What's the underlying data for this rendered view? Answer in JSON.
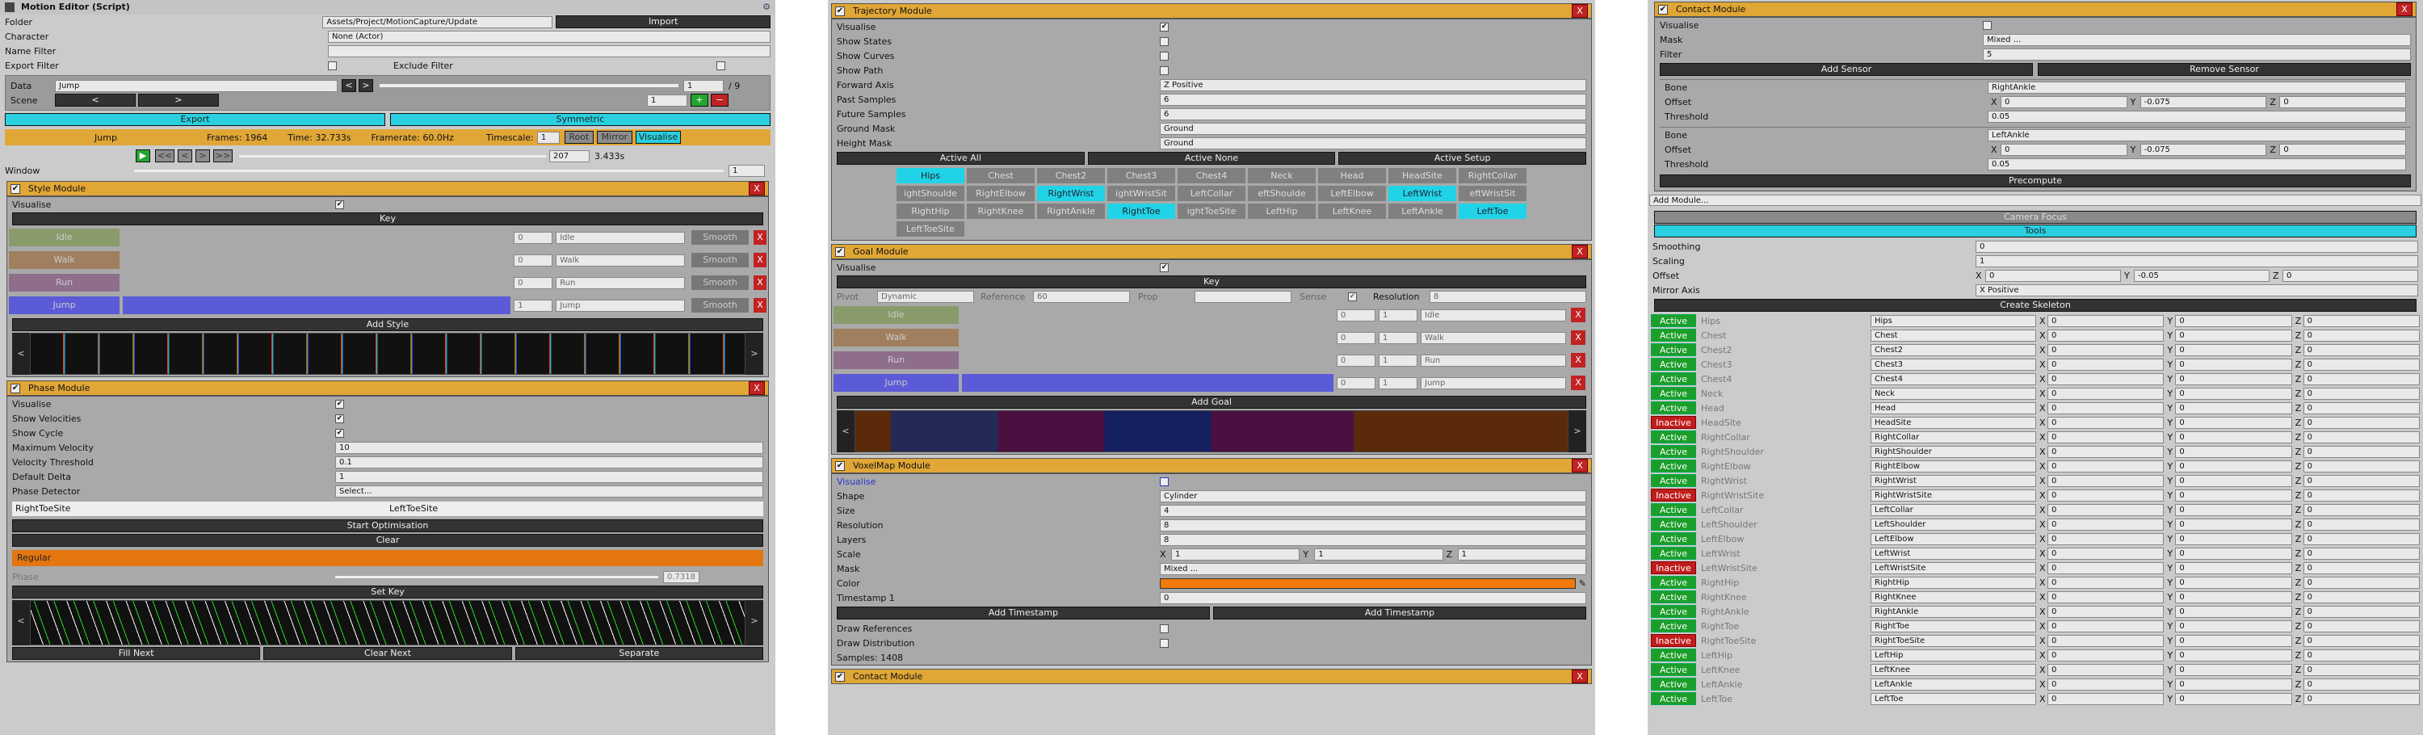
{
  "col1": {
    "title": "Motion Editor (Script)",
    "folder_label": "Folder",
    "folder_value": "Assets/Project/MotionCapture/Update",
    "import": "Import",
    "character_label": "Character",
    "character_value": "None (Actor)",
    "namefilter_label": "Name Filter",
    "exportfilter_label": "Export Filter",
    "excludefilter_label": "Exclude Filter",
    "data_label": "Data",
    "data_value": "Jump",
    "data_page": "1",
    "data_total": "/ 9",
    "scene_label": "Scene",
    "scene_page": "1",
    "export": "Export",
    "symmetric": "Symmetric",
    "clip_name": "Jump",
    "frames": "Frames: 1964",
    "time": "Time: 32.733s",
    "framerate": "Framerate: 60.0Hz",
    "timescale_label": "Timescale:",
    "timescale_value": "1",
    "root": "Root",
    "mirror": "Mirror",
    "visualise": "Visualise",
    "frame_value": "207",
    "frame_time": "3.433s",
    "window_label": "Window",
    "window_value": "1",
    "style": {
      "title": "Style Module",
      "visualise": "Visualise",
      "key": "Key",
      "add": "Add Style",
      "rows": [
        {
          "name": "Idle",
          "val": "0",
          "label": "Idle",
          "smooth": "Smooth"
        },
        {
          "name": "Walk",
          "val": "0",
          "label": "Walk",
          "smooth": "Smooth"
        },
        {
          "name": "Run",
          "val": "0",
          "label": "Run",
          "smooth": "Smooth"
        },
        {
          "name": "Jump",
          "val": "1",
          "label": "Jump",
          "smooth": "Smooth"
        }
      ]
    },
    "phase": {
      "title": "Phase Module",
      "visualise": "Visualise",
      "showvel": "Show Velocities",
      "showcycle": "Show Cycle",
      "maxvel": "Maximum Velocity",
      "maxvel_v": "10",
      "velth": "Velocity Threshold",
      "velth_v": "0.1",
      "defdelta": "Default Delta",
      "defdelta_v": "1",
      "detector": "Phase Detector",
      "detector_v": "Select...",
      "rts": "RightToeSite",
      "lts": "LeftToeSite",
      "start": "Start Optimisation",
      "clear": "Clear",
      "regular": "Regular",
      "phase": "Phase",
      "phase_v": "0.7318",
      "setkey": "Set Key",
      "fillnext": "Fill Next",
      "clearnext": "Clear Next",
      "separate": "Separate"
    }
  },
  "col2": {
    "traj": {
      "title": "Trajectory Module",
      "rows": [
        {
          "l": "Visualise",
          "t": "chk",
          "v": "✔"
        },
        {
          "l": "Show States",
          "t": "chk",
          "v": ""
        },
        {
          "l": "Show Curves",
          "t": "chk",
          "v": ""
        },
        {
          "l": "Show Path",
          "t": "chk",
          "v": ""
        },
        {
          "l": "Forward Axis",
          "t": "sel",
          "v": "Z Positive"
        },
        {
          "l": "Past Samples",
          "t": "inp",
          "v": "6"
        },
        {
          "l": "Future Samples",
          "t": "inp",
          "v": "6"
        },
        {
          "l": "Ground Mask",
          "t": "sel",
          "v": "Ground"
        },
        {
          "l": "Height Mask",
          "t": "sel",
          "v": "Ground"
        }
      ],
      "activeall": "Active All",
      "activenone": "Active None",
      "activesetup": "Active Setup",
      "bones": [
        [
          "Hips",
          1
        ],
        [
          "Chest",
          0
        ],
        [
          "Chest2",
          0
        ],
        [
          "Chest3",
          0
        ],
        [
          "Chest4",
          0
        ],
        [
          "Neck",
          0
        ],
        [
          "Head",
          0
        ],
        [
          "HeadSite",
          0
        ],
        [
          "RightCollar",
          0
        ],
        [
          "ightShoulde",
          0
        ],
        [
          "RightElbow",
          0
        ],
        [
          "RightWrist",
          1
        ],
        [
          "ightWristSit",
          0
        ],
        [
          "LeftCollar",
          0
        ],
        [
          "eftShoulde",
          0
        ],
        [
          "LeftElbow",
          0
        ],
        [
          "LeftWrist",
          1
        ],
        [
          "eftWristSit",
          0
        ],
        [
          "RightHip",
          0
        ],
        [
          "RightKnee",
          0
        ],
        [
          "RightAnkle",
          0
        ],
        [
          "RightToe",
          1
        ],
        [
          "ightToeSite",
          0
        ],
        [
          "LeftHip",
          0
        ],
        [
          "LeftKnee",
          0
        ],
        [
          "LeftAnkle",
          0
        ],
        [
          "LeftToe",
          1
        ],
        [
          "LeftToeSite",
          0
        ]
      ]
    },
    "goal": {
      "title": "Goal Module",
      "visualise": "Visualise",
      "key": "Key",
      "pivot": "Pivot",
      "pivot_v": "Dynamic",
      "reference": "Reference",
      "ref_v": "60",
      "prop": "Prop",
      "sense": "Sense",
      "resolution": "Resolution",
      "res_v": "8",
      "rows": [
        {
          "name": "Idle",
          "label": "Idle"
        },
        {
          "name": "Walk",
          "label": "Walk"
        },
        {
          "name": "Run",
          "label": "Run"
        },
        {
          "name": "Jump",
          "label": "Jump"
        }
      ],
      "add": "Add Goal"
    },
    "voxel": {
      "title": "VoxelMap Module",
      "visualise": "Visualise",
      "shape": "Shape",
      "shape_v": "Cylinder",
      "size": "Size",
      "size_v": "4",
      "resolution": "Resolution",
      "res_v": "8",
      "layers": "Layers",
      "layers_v": "8",
      "scale": "Scale",
      "sx": "1",
      "sy": "1",
      "sz": "1",
      "mask": "Mask",
      "mask_v": "Mixed ...",
      "color": "Color",
      "timestamp": "Timestamp 1",
      "ts_v": "0",
      "addts1": "Add Timestamp",
      "addts2": "Add Timestamp",
      "drawref": "Draw References",
      "drawdist": "Draw Distribution",
      "samples": "Samples: 1408"
    },
    "contact": {
      "title": "Contact Module"
    }
  },
  "col3": {
    "contact": {
      "title": "Contact Module",
      "visualise": "Visualise",
      "mask": "Mask",
      "mask_v": "Mixed ...",
      "filter": "Filter",
      "filter_v": "5",
      "add": "Add Sensor",
      "remove": "Remove Sensor",
      "sensors": [
        {
          "bone": "RightAnkle",
          "ox": "0",
          "oy": "-0.075",
          "oz": "0",
          "th": "0.05"
        },
        {
          "bone": "LeftAnkle",
          "ox": "0",
          "oy": "-0.075",
          "oz": "0",
          "th": "0.05"
        }
      ],
      "precompute": "Precompute",
      "bone_l": "Bone",
      "offset_l": "Offset",
      "threshold_l": "Threshold"
    },
    "addmodule": "Add Module...",
    "camerafocus": "Camera Focus",
    "tools": "Tools",
    "smoothing": "Smoothing",
    "smoothing_v": "0",
    "scaling": "Scaling",
    "scaling_v": "1",
    "offset": "Offset",
    "ox": "0",
    "oy": "-0.05",
    "oz": "0",
    "mirror": "Mirror Axis",
    "mirror_v": "X Positive",
    "create": "Create Skeleton",
    "skeleton": [
      [
        "Hips",
        1
      ],
      [
        "Chest",
        1
      ],
      [
        "Chest2",
        1
      ],
      [
        "Chest3",
        1
      ],
      [
        "Chest4",
        1
      ],
      [
        "Neck",
        1
      ],
      [
        "Head",
        1
      ],
      [
        "HeadSite",
        0
      ],
      [
        "RightCollar",
        1
      ],
      [
        "RightShoulder",
        1
      ],
      [
        "RightElbow",
        1
      ],
      [
        "RightWrist",
        1
      ],
      [
        "RightWristSite",
        0
      ],
      [
        "LeftCollar",
        1
      ],
      [
        "LeftShoulder",
        1
      ],
      [
        "LeftElbow",
        1
      ],
      [
        "LeftWrist",
        1
      ],
      [
        "LeftWristSite",
        0
      ],
      [
        "RightHip",
        1
      ],
      [
        "RightKnee",
        1
      ],
      [
        "RightAnkle",
        1
      ],
      [
        "RightToe",
        1
      ],
      [
        "RightToeSite",
        0
      ],
      [
        "LeftHip",
        1
      ],
      [
        "LeftKnee",
        1
      ],
      [
        "LeftAnkle",
        1
      ],
      [
        "LeftToe",
        1
      ]
    ],
    "active": "Active",
    "inactive": "Inactive",
    "zero": "0"
  }
}
